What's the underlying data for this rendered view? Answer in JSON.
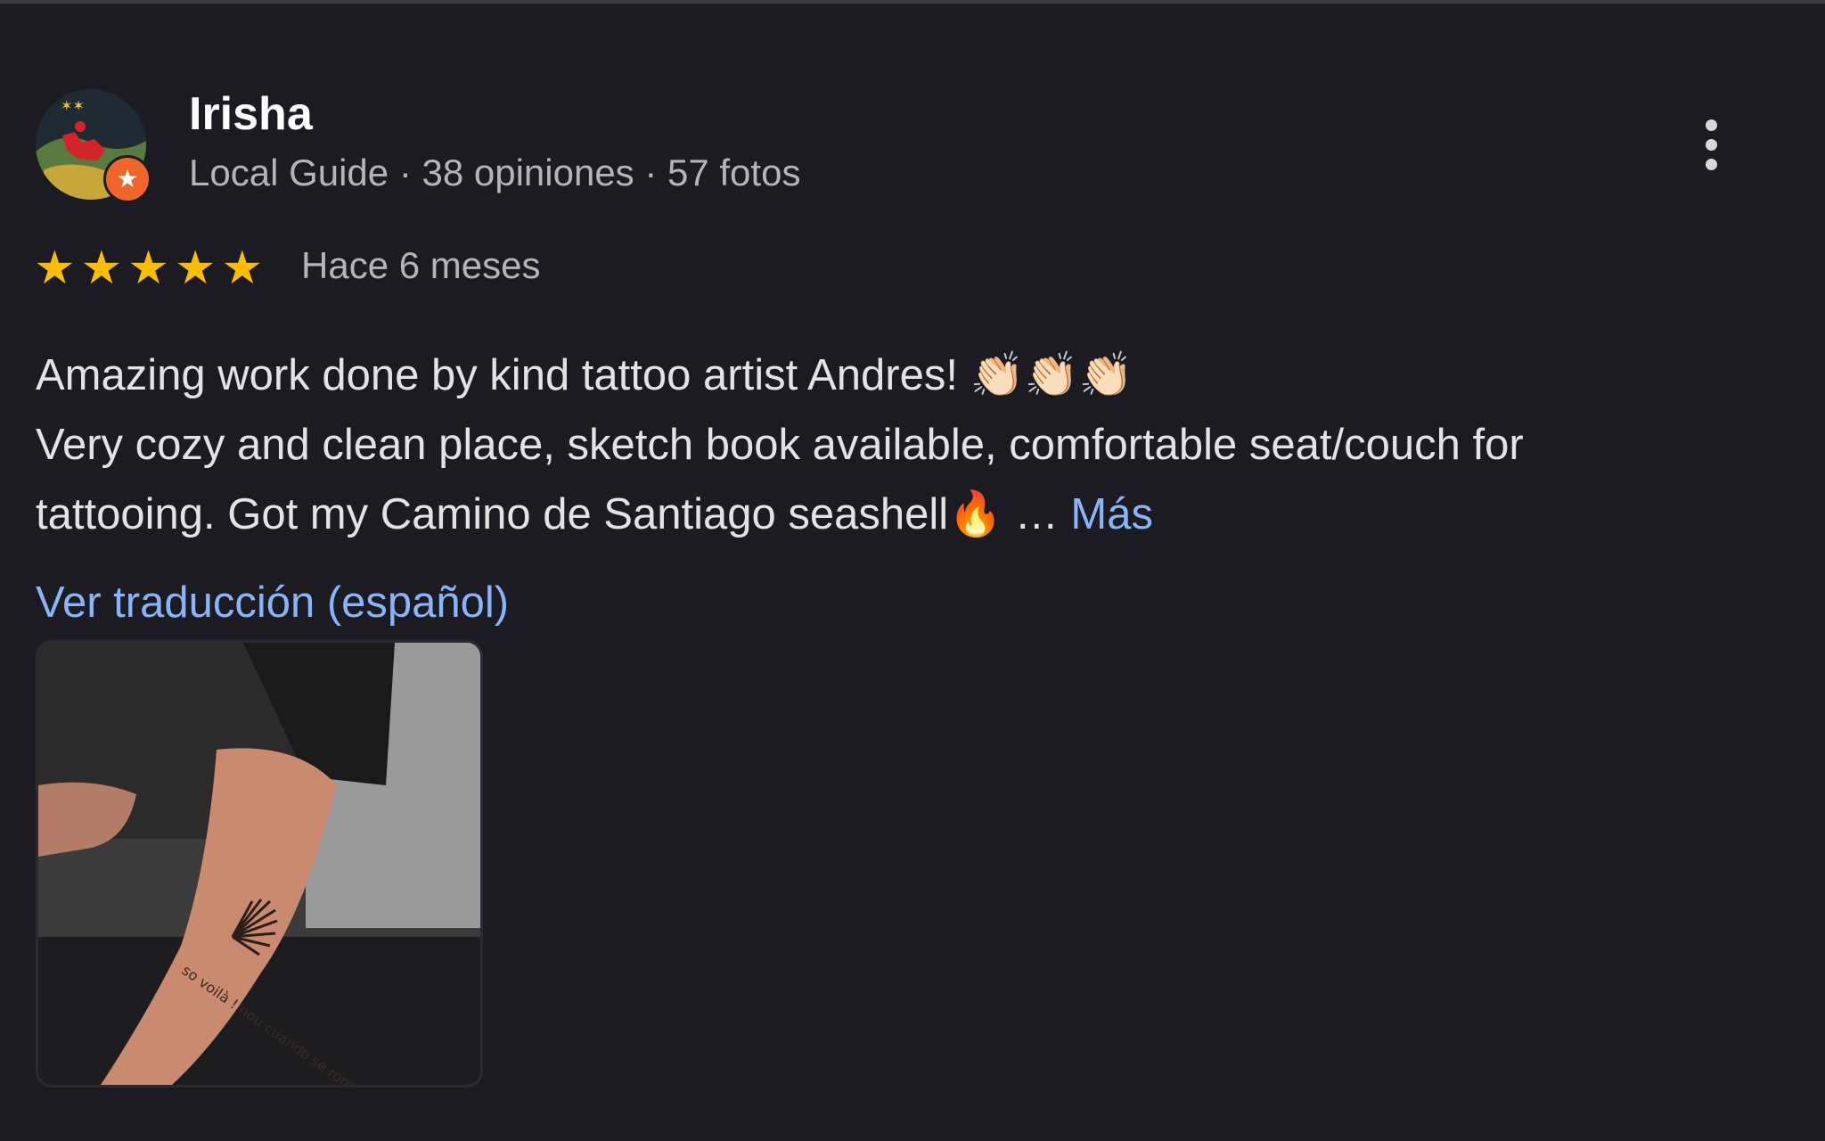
{
  "review": {
    "author": "Irisha",
    "meta": "Local Guide · 38 opiniones · 57 fotos",
    "rating": 5,
    "rating_max": 5,
    "time": "Hace 6 meses",
    "text_lines": [
      "Amazing work done by kind tattoo artist Andres! 👏🏻👏🏻👏🏻",
      "Very cozy and clean place, sketch book available, comfortable seat/couch for",
      "tattooing. Got my Camino de Santiago seashell🔥 … "
    ],
    "more_label": "Más",
    "translate_label": "Ver traducción (español)",
    "photo_tattoo_text": "so voilà ! nou cuando se rompa el cuore"
  },
  "icons": {
    "avatar": "avatar-image",
    "badge": "local-guide-star-icon",
    "menu": "more-vert-icon",
    "star": "star-icon"
  },
  "colors": {
    "background": "#1b1b21",
    "star": "#fbbc04",
    "link": "#8ab4f8",
    "badge": "#f0662a"
  }
}
